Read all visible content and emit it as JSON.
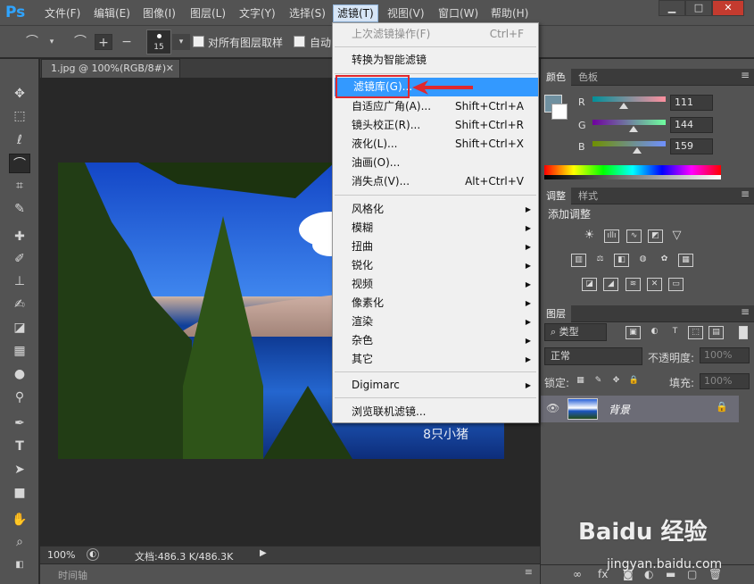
{
  "app": {
    "logo": "Ps"
  },
  "menubar": [
    "文件(F)",
    "编辑(E)",
    "图像(I)",
    "图层(L)",
    "文字(Y)",
    "选择(S)",
    "滤镜(T)",
    "视图(V)",
    "窗口(W)",
    "帮助(H)"
  ],
  "options": {
    "brush_size": "15",
    "sample_all_layers": "对所有图层取样",
    "auto_enhance": "自动"
  },
  "document": {
    "tab_title": "1.jpg @ 100%(RGB/8#)",
    "watermark": "8只小猪"
  },
  "status": {
    "zoom": "100%",
    "doc_size": "文档:486.3 K/486.3K",
    "timeline": "时间轴"
  },
  "filter_menu": [
    {
      "label": "上次滤镜操作(F)",
      "shortcut": "Ctrl+F"
    },
    {
      "label": "转换为智能滤镜"
    },
    {
      "label": "滤镜库(G)..."
    },
    {
      "label": "自适应广角(A)...",
      "shortcut": "Shift+Ctrl+A"
    },
    {
      "label": "镜头校正(R)...",
      "shortcut": "Shift+Ctrl+R"
    },
    {
      "label": "液化(L)...",
      "shortcut": "Shift+Ctrl+X"
    },
    {
      "label": "油画(O)..."
    },
    {
      "label": "消失点(V)...",
      "shortcut": "Alt+Ctrl+V"
    },
    {
      "label": "风格化"
    },
    {
      "label": "模糊"
    },
    {
      "label": "扭曲"
    },
    {
      "label": "锐化"
    },
    {
      "label": "视频"
    },
    {
      "label": "像素化"
    },
    {
      "label": "渲染"
    },
    {
      "label": "杂色"
    },
    {
      "label": "其它"
    },
    {
      "label": "Digimarc"
    },
    {
      "label": "浏览联机滤镜..."
    }
  ],
  "panels": {
    "color_tab": "颜色",
    "swatches_tab": "色板",
    "color": {
      "r_label": "R",
      "g_label": "G",
      "b_label": "B",
      "r": "111",
      "g": "144",
      "b": "159",
      "foreground": "#6f909f"
    },
    "adjust_tab": "调整",
    "styles_tab": "样式",
    "add_adjustment": "添加调整",
    "layers_tab": "图层",
    "layers": {
      "filter": "类型",
      "blend_mode": "正常",
      "opacity_label": "不透明度:",
      "opacity": "100%",
      "lock_label": "锁定:",
      "fill_label": "填充:",
      "fill": "100%",
      "layer_name": "背景"
    }
  },
  "watermark": {
    "brand": "Baidu 经验",
    "url": "jingyan.baidu.com"
  }
}
